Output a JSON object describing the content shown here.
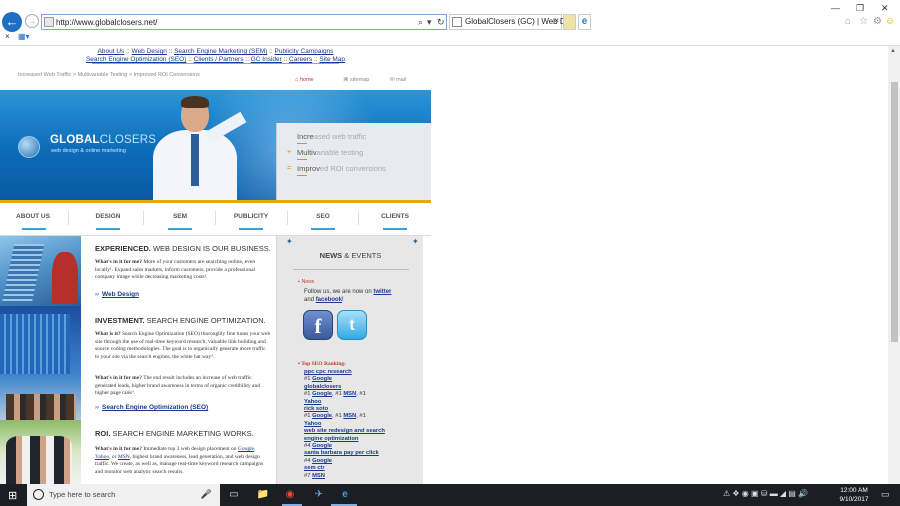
{
  "browser": {
    "url": "http://www.globalclosers.net/",
    "tab_title": "GlobalClosers (GC) | Web D...",
    "tab_close": "×",
    "back_glyph": "←",
    "fwd_glyph": "→",
    "search_glyph": "⌕",
    "search_dropdown": "▾",
    "refresh_glyph": "↻",
    "minimize": "—",
    "restore": "❐",
    "close": "✕",
    "home_glyph": "⌂",
    "fav_glyph": "☆",
    "settings_glyph": "⚙",
    "smiley_glyph": "☺",
    "cmd_close": "×",
    "cmd_menu": "▦▾",
    "ie_glyph": "e"
  },
  "site": {
    "top_links": [
      {
        "label": "About Us",
        "sep": " :: "
      },
      {
        "label": "Web Design",
        "sep": " :: "
      },
      {
        "label": "Search Engine Marketing (SEM)",
        "sep": " :: "
      },
      {
        "label": "Publicity Campaigns",
        "sep": ""
      }
    ],
    "top_links2": [
      {
        "label": "Search Engine Optimization (SEO)",
        "sep": " :: "
      },
      {
        "label": "Clients / Partners",
        "sep": " :: "
      },
      {
        "label": "GC Insider",
        "sep": " :: "
      },
      {
        "label": "Careers",
        "sep": " :: "
      },
      {
        "label": "Site Map",
        "sep": ""
      }
    ],
    "breadcrumbs": "Increased Web Traffic   >   Multivariable Testing   >   Improved ROI Conversions",
    "util": {
      "home": "home",
      "sitemap": "sitemap",
      "mail": "mail"
    },
    "logo": {
      "bold": "GLOBAL",
      "light": "CLOSERS",
      "tagline": "web design & online marketing"
    },
    "hero_items": [
      {
        "hl": "Incre",
        "rest": "ased web traffic",
        "mark": ""
      },
      {
        "hl": "Multiv",
        "rest": "ariable testing",
        "mark": "+"
      },
      {
        "hl": "Improv",
        "rest": "ed ROI conversions",
        "mark": "="
      }
    ],
    "nav": [
      "ABOUT US",
      "DESIGN",
      "SEM",
      "PUBLICITY",
      "SEO",
      "CLIENTS"
    ],
    "sections": {
      "s1": {
        "title_bold": "EXPERIENCED.",
        "title_rest": " WEB DESIGN IS OUR BUSINESS.",
        "p1_bold": "What's in it for me?",
        "p1_rest": " More of your customers are searching online, even locally¹. Expand sales markets, inform customers, provide a professional company image while decreasing marketing costs².",
        "more_arrow": "››",
        "more": "Web Design"
      },
      "s2": {
        "title_bold": "INVESTMENT.",
        "title_rest": " SEARCH ENGINE OPTIMIZATION.",
        "p1_bold": "What is it?",
        "p1_rest": " Search Engine Optimization (SEO) thoroughly fine tunes your web site through the use of real-time keyword research, valuable link building and source coding methodologies. The goal is to organically generate more traffic to your site via the search engines, the white hat way³.",
        "p2_bold": "What's in it for me?",
        "p2_rest": " The end result includes an increase of web traffic generated leads, higher brand awareness in terms of organic credibility and higher page rank⁵.",
        "more_arrow": "››",
        "more": "Search Engine Optimization (SEO)"
      },
      "s3": {
        "title_bold": "ROI.",
        "title_rest": " SEARCH ENGINE MARKETING WORKS.",
        "p1_bold": "What's in it for me?",
        "p1_a": " Immediate top 3 web design placement on ",
        "google": "Google",
        "c1": ", ",
        "yahoo": "Yahoo",
        "c2": ", or ",
        "msn": "MSN",
        "p1_b": ", highest brand awareness, lead generation, and web design traffic. We create, as well as, manage real-time keyword research campaigns and monitor web analytic search results."
      }
    },
    "news": {
      "pin": "📍",
      "title_bold": "NEWS",
      "title_rest": " & EVENTS",
      "label_dot": "▪",
      "label": "News",
      "line1": "Follow us, we are now on ",
      "twitter": "twitter",
      "line2": "and ",
      "facebook": "facebook",
      "line2_end": "!",
      "fb_icon": "f",
      "tw_icon": "t",
      "seo_label": "Top SEO Ranking:",
      "rankings": [
        {
          "kind": "link",
          "text": "ppc cpc research"
        },
        {
          "kind": "rank",
          "parts": [
            "#1 ",
            "Google"
          ]
        },
        {
          "kind": "link",
          "text": "globalclosers"
        },
        {
          "kind": "rank3",
          "parts": [
            "#1 ",
            "Google",
            ", #1 ",
            "MSN",
            ", #1"
          ]
        },
        {
          "kind": "link",
          "text": "Yahoo"
        },
        {
          "kind": "link",
          "text": "rick soto"
        },
        {
          "kind": "rank3",
          "parts": [
            "#1 ",
            "Google",
            ", #1 ",
            "MSN",
            ", #1"
          ]
        },
        {
          "kind": "link",
          "text": "Yahoo"
        },
        {
          "kind": "link",
          "text": "web site redesign and search"
        },
        {
          "kind": "link",
          "text": "engine optimization"
        },
        {
          "kind": "rank",
          "parts": [
            "#4 ",
            "Google"
          ]
        },
        {
          "kind": "link",
          "text": "santa barbara pay per click"
        },
        {
          "kind": "rank",
          "parts": [
            "#4 ",
            "Google"
          ]
        },
        {
          "kind": "link",
          "text": "sem ctr"
        },
        {
          "kind": "rank",
          "parts": [
            "#7 ",
            "MSN"
          ]
        }
      ]
    }
  },
  "taskbar": {
    "start": "⊞",
    "search_placeholder": "Type here to search",
    "mic": "🎤",
    "time": "12:00 AM",
    "date": "9/10/2017",
    "tray": "⚠ ❖ ◉ ▣ ⛁ ▬ ◢ ▤ 🔊",
    "notif": "▭",
    "apps": [
      "▭",
      "📁",
      "◉",
      "✈",
      "e"
    ]
  },
  "colors": {
    "accent_blue": "#1e6fc4",
    "orange": "#f0a316",
    "link": "#1a3a8c",
    "news_red": "#c0392b"
  }
}
